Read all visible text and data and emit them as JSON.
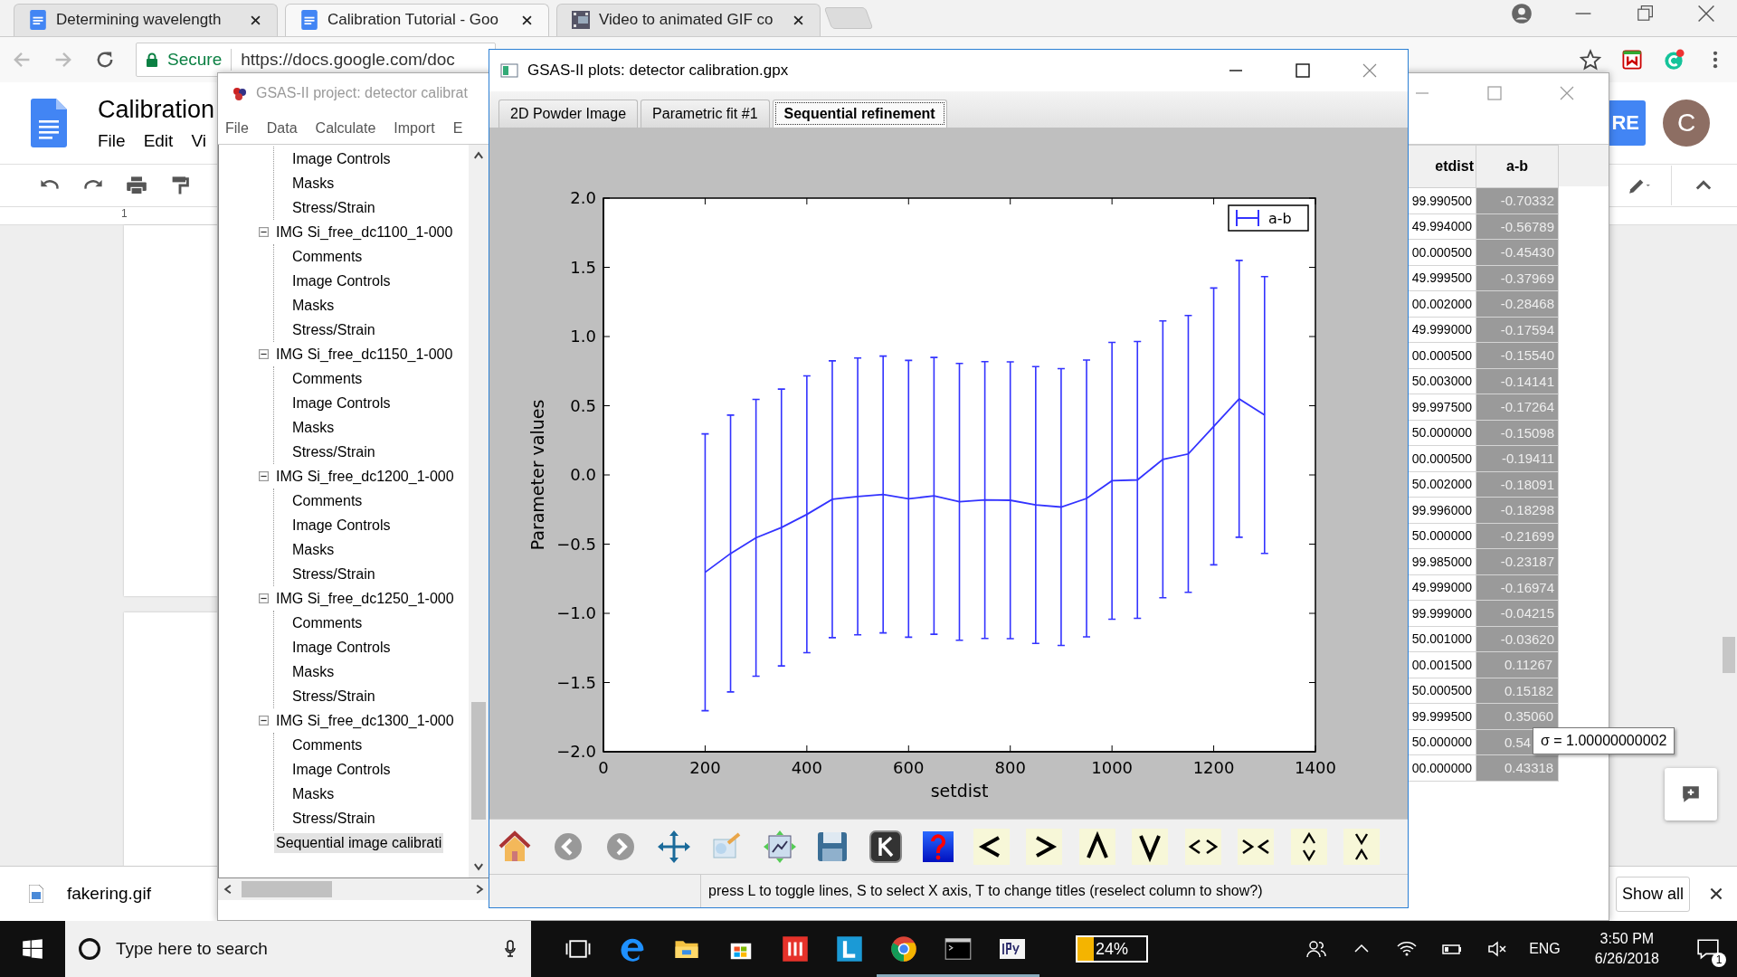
{
  "browser": {
    "tabs": [
      {
        "title": "Determining wavelength",
        "selected": false
      },
      {
        "title": "Calibration Tutorial - Goo",
        "selected": true
      },
      {
        "title": "Video to animated GIF co",
        "selected": false
      }
    ],
    "secure_label": "Secure",
    "url": "https://docs.google.com/doc"
  },
  "docs": {
    "title": "Calibration",
    "menu": [
      "File",
      "Edit",
      "Vi"
    ],
    "share_button": "RE",
    "avatar": "C",
    "ruler_mark": "1"
  },
  "download_bar": {
    "file": "fakering.gif",
    "show_all": "Show all"
  },
  "project_window": {
    "title": "GSAS-II project: detector calibrat",
    "menu": [
      "File",
      "Data",
      "Calculate",
      "Import",
      "E"
    ],
    "tree": {
      "continued_children": [
        {
          "label": "Image Controls",
          "selected": false
        },
        {
          "label": "Masks",
          "selected": false
        },
        {
          "label": "Stress/Strain",
          "selected": false
        }
      ],
      "nodes": [
        {
          "label": "IMG Si_free_dc1100_1-000",
          "selected": false,
          "expanded": true,
          "children": [
            {
              "label": "Comments",
              "selected": false
            },
            {
              "label": "Image Controls",
              "selected": false
            },
            {
              "label": "Masks",
              "selected": false
            },
            {
              "label": "Stress/Strain",
              "selected": false
            }
          ]
        },
        {
          "label": "IMG Si_free_dc1150_1-000",
          "selected": false,
          "expanded": true,
          "children": [
            {
              "label": "Comments",
              "selected": false
            },
            {
              "label": "Image Controls",
              "selected": false
            },
            {
              "label": "Masks",
              "selected": false
            },
            {
              "label": "Stress/Strain",
              "selected": false
            }
          ]
        },
        {
          "label": "IMG Si_free_dc1200_1-000",
          "selected": false,
          "expanded": true,
          "children": [
            {
              "label": "Comments",
              "selected": false
            },
            {
              "label": "Image Controls",
              "selected": false
            },
            {
              "label": "Masks",
              "selected": false
            },
            {
              "label": "Stress/Strain",
              "selected": false
            }
          ]
        },
        {
          "label": "IMG Si_free_dc1250_1-000",
          "selected": false,
          "expanded": true,
          "children": [
            {
              "label": "Comments",
              "selected": false
            },
            {
              "label": "Image Controls",
              "selected": false
            },
            {
              "label": "Masks",
              "selected": false
            },
            {
              "label": "Stress/Strain",
              "selected": false
            }
          ]
        },
        {
          "label": "IMG Si_free_dc1300_1-000",
          "selected": false,
          "expanded": true,
          "children": [
            {
              "label": "Comments",
              "selected": false
            },
            {
              "label": "Image Controls",
              "selected": false
            },
            {
              "label": "Masks",
              "selected": false
            },
            {
              "label": "Stress/Strain",
              "selected": false
            }
          ]
        },
        {
          "label": "Sequential image calibrati",
          "selected": true
        }
      ]
    },
    "table": {
      "columns": [
        {
          "label": "etdist",
          "selected": false
        },
        {
          "label": "a-b",
          "selected": true
        }
      ],
      "rows": [
        [
          "99.990500",
          "-0.70332"
        ],
        [
          "49.994000",
          "-0.56789"
        ],
        [
          "00.000500",
          "-0.45430"
        ],
        [
          "49.999500",
          "-0.37969"
        ],
        [
          "00.002000",
          "-0.28468"
        ],
        [
          "49.999000",
          "-0.17594"
        ],
        [
          "00.000500",
          "-0.15540"
        ],
        [
          "50.003000",
          "-0.14141"
        ],
        [
          "99.997500",
          "-0.17264"
        ],
        [
          "50.000000",
          "-0.15098"
        ],
        [
          "00.000500",
          "-0.19411"
        ],
        [
          "50.002000",
          "-0.18091"
        ],
        [
          "99.996000",
          "-0.18298"
        ],
        [
          "50.000000",
          "-0.21699"
        ],
        [
          "99.985000",
          "-0.23187"
        ],
        [
          "49.999000",
          "-0.16974"
        ],
        [
          "99.999000",
          "-0.04215"
        ],
        [
          "50.001000",
          "-0.03620"
        ],
        [
          "00.001500",
          "0.11267"
        ],
        [
          "50.000500",
          "0.15182"
        ],
        [
          "99.999500",
          "0.35060"
        ],
        [
          "50.000000",
          "0.54"
        ],
        [
          "00.000000",
          "0.43318"
        ]
      ]
    },
    "tooltip": "σ = 1.00000000002"
  },
  "plot_window": {
    "title": "GSAS-II plots: detector calibration.gpx",
    "tabs": [
      {
        "label": "2D Powder Image",
        "selected": false
      },
      {
        "label": "Parametric fit #1",
        "selected": false
      },
      {
        "label": "Sequential refinement",
        "selected": true
      }
    ],
    "chart_data": {
      "type": "line",
      "xlabel": "setdist",
      "ylabel": "Parameter values",
      "x": [
        200,
        250,
        300,
        350,
        400,
        450,
        500,
        550,
        600,
        650,
        700,
        750,
        800,
        850,
        900,
        950,
        1000,
        1050,
        1100,
        1150,
        1200,
        1250,
        1300
      ],
      "series": [
        {
          "name": "a-b",
          "color": "#3333ff",
          "errors": [
            1,
            1,
            1,
            1,
            1,
            1,
            1,
            1,
            1,
            1,
            1,
            1,
            1,
            1,
            1,
            1,
            1,
            1,
            1,
            1,
            1,
            1,
            1
          ],
          "values": [
            -0.70332,
            -0.56789,
            -0.4543,
            -0.37969,
            -0.28468,
            -0.17594,
            -0.1554,
            -0.14141,
            -0.17264,
            -0.15098,
            -0.19411,
            -0.18091,
            -0.18298,
            -0.21699,
            -0.23187,
            -0.16974,
            -0.04215,
            -0.0362,
            0.11267,
            0.15182,
            0.3506,
            0.55,
            0.43318
          ]
        }
      ],
      "xlim": [
        0,
        1400
      ],
      "ylim": [
        -2,
        2
      ],
      "xticks": [
        0,
        200,
        400,
        600,
        800,
        1000,
        1200,
        1400
      ],
      "yticks": [
        {
          "value": -2,
          "label": "−2.0"
        },
        {
          "value": -1.5,
          "label": "−1.5"
        },
        {
          "value": -1,
          "label": "−1.0"
        },
        {
          "value": -0.5,
          "label": "−0.5"
        },
        {
          "value": 0,
          "label": "0.0"
        },
        {
          "value": 0.5,
          "label": "0.5"
        },
        {
          "value": 1,
          "label": "1.0"
        },
        {
          "value": 1.5,
          "label": "1.5"
        },
        {
          "value": 2,
          "label": "2.0"
        }
      ]
    },
    "status": "press L to toggle lines, S to select X axis, T to change titles (reselect column to show?)"
  },
  "taskbar": {
    "search_placeholder": "Type here to search",
    "battery_app": {
      "label": "24%",
      "level": 0.24
    },
    "language": "ENG",
    "time": "3:50 PM",
    "date": "6/26/2018",
    "notifications": "1"
  }
}
